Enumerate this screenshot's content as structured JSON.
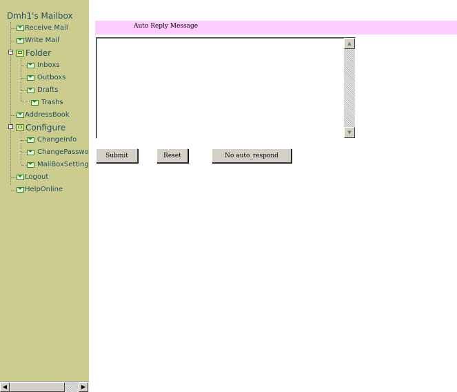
{
  "sidebar": {
    "title": "Dmh1's Mailbox",
    "items": [
      {
        "label": "Receive Mail"
      },
      {
        "label": "Write Mail"
      },
      {
        "label": "Folder"
      },
      {
        "label": "Inboxs"
      },
      {
        "label": "Outboxs"
      },
      {
        "label": "Drafts"
      },
      {
        "label": "Trashs"
      },
      {
        "label": "AddressBook"
      },
      {
        "label": "Configure"
      },
      {
        "label": "ChangeInfo"
      },
      {
        "label": "ChangePassword"
      },
      {
        "label": "MailBoxSetting"
      },
      {
        "label": "Logout"
      },
      {
        "label": "HelpOnline"
      }
    ]
  },
  "main": {
    "header": "Auto Reply Message",
    "message_value": "",
    "buttons": {
      "submit": "Submit",
      "reset": "Reset",
      "no_respond": "No auto_respond"
    }
  },
  "colors": {
    "sidebar_bg": "#cccc8e",
    "header_bg": "#ffccff",
    "link": "#1f4e66"
  }
}
